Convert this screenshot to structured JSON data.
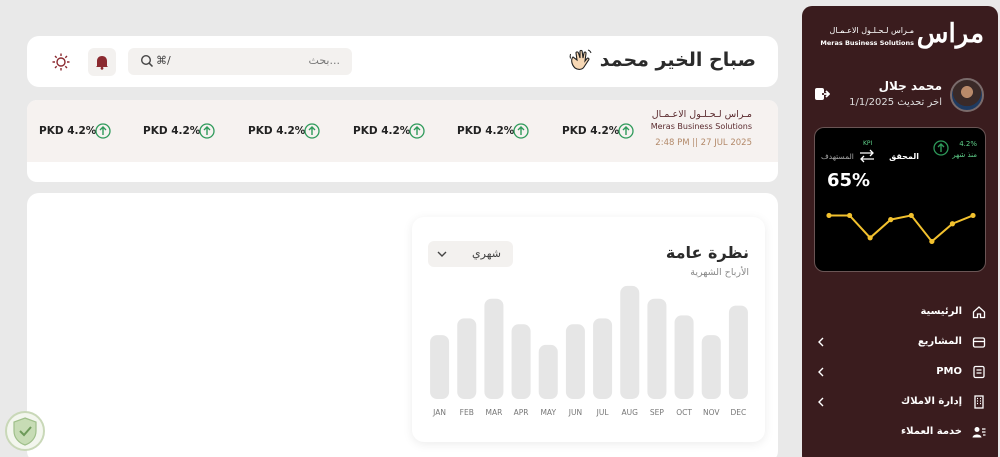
{
  "sidebar": {
    "logo_main": "مراس",
    "logo_ar": "مـراس لـحـلـول الاعـمـال",
    "logo_en": "Meras Business Solutions",
    "user_name": "محمد جلال",
    "last_update": "اخر تحديث 1/1/2025",
    "kpi": {
      "pct": "4.2%",
      "since": "منذ شهر",
      "kpi_label": "KPI",
      "achieved": "المحقق",
      "target": "المستهدف",
      "value": "65%",
      "sparkline": [
        0.78,
        0.78,
        0.35,
        0.7,
        0.78,
        0.28,
        0.62,
        0.78
      ]
    },
    "menu": [
      {
        "label": "الرئيسية",
        "icon": "home-icon",
        "chevron": false
      },
      {
        "label": "المشاريع",
        "icon": "projects-icon",
        "chevron": true
      },
      {
        "label": "PMO",
        "icon": "pmo-icon",
        "chevron": true
      },
      {
        "label": "إدارة الاملاك",
        "icon": "building-icon",
        "chevron": true
      },
      {
        "label": "خدمة العملاء",
        "icon": "customers-icon",
        "chevron": false
      }
    ]
  },
  "header": {
    "greeting": "صباح الخير محمد",
    "search_placeholder": "بحث...",
    "search_shortcut": "⌘/"
  },
  "ticker": {
    "company_ar": "مـراس لـحـلـول الاعـمـال",
    "company_en": "Meras Business Solutions",
    "time": "2:48 PM || 27 JUL 2025",
    "items": [
      "PKD 4.2%",
      "PKD 4.2%",
      "PKD 4.2%",
      "PKD 4.2%",
      "PKD 4.2%",
      "PKD 4.2%"
    ]
  },
  "overview": {
    "title": "نظرة عامة",
    "subtitle": "الأرباح الشهرية",
    "period": "شهري"
  },
  "chart_data": {
    "type": "bar",
    "title": "نظرة عامة",
    "subtitle": "الأرباح الشهرية",
    "categories": [
      "JAN",
      "FEB",
      "MAR",
      "APR",
      "MAY",
      "JUN",
      "JUL",
      "AUG",
      "SEP",
      "OCT",
      "NOV",
      "DEC"
    ],
    "values": [
      65,
      82,
      102,
      76,
      55,
      76,
      82,
      115,
      102,
      85,
      65,
      95
    ],
    "ylim": [
      0,
      120
    ],
    "grid": false,
    "colors": {
      "bar": "#e6e6e6"
    }
  },
  "colors": {
    "sidebar_bg": "#3a1c1e",
    "accent_green": "#2e9a5a",
    "spark_line": "#f2c12e",
    "brand_text": "#5a2a2e"
  }
}
